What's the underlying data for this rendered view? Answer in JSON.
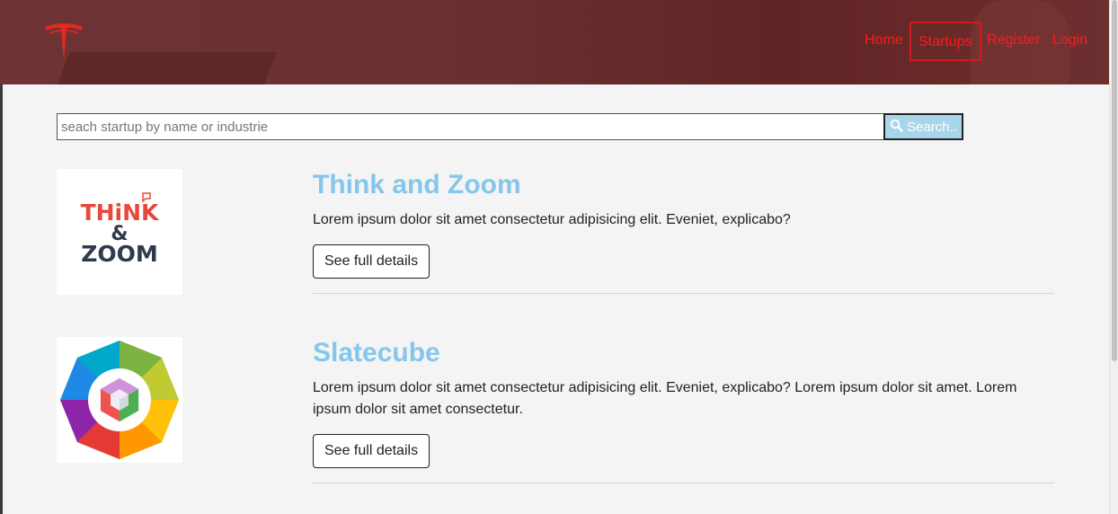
{
  "header": {
    "logo_icon": "tesla-logo-icon",
    "nav": [
      {
        "label": "Home",
        "active": false
      },
      {
        "label": "Startups",
        "active": true
      },
      {
        "label": "Register",
        "active": false
      },
      {
        "label": "Login",
        "active": false
      }
    ],
    "nav_color": "#ff1a1a"
  },
  "search": {
    "placeholder": "seach startup by name or industrie",
    "value": "",
    "button_label": "Search..",
    "button_icon": "search-icon"
  },
  "startups": [
    {
      "name": "Think and Zoom",
      "logo_text": [
        "THiNK",
        "&",
        "ZOOM"
      ],
      "description": "Lorem ipsum dolor sit amet consectetur adipisicing elit. Eveniet, explicabo?",
      "button_label": "See full details"
    },
    {
      "name": "Slatecube",
      "logo_icon": "slatecube-logo-icon",
      "description": "Lorem ipsum dolor sit amet consectetur adipisicing elit. Eveniet, explicabo? Lorem ipsum dolor sit amet. Lorem ipsum dolor sit amet consectetur.",
      "button_label": "See full details"
    }
  ],
  "colors": {
    "accent_title": "#85c7ec",
    "search_button": "#a7d6ea",
    "header_bg": "#6a2e30"
  }
}
